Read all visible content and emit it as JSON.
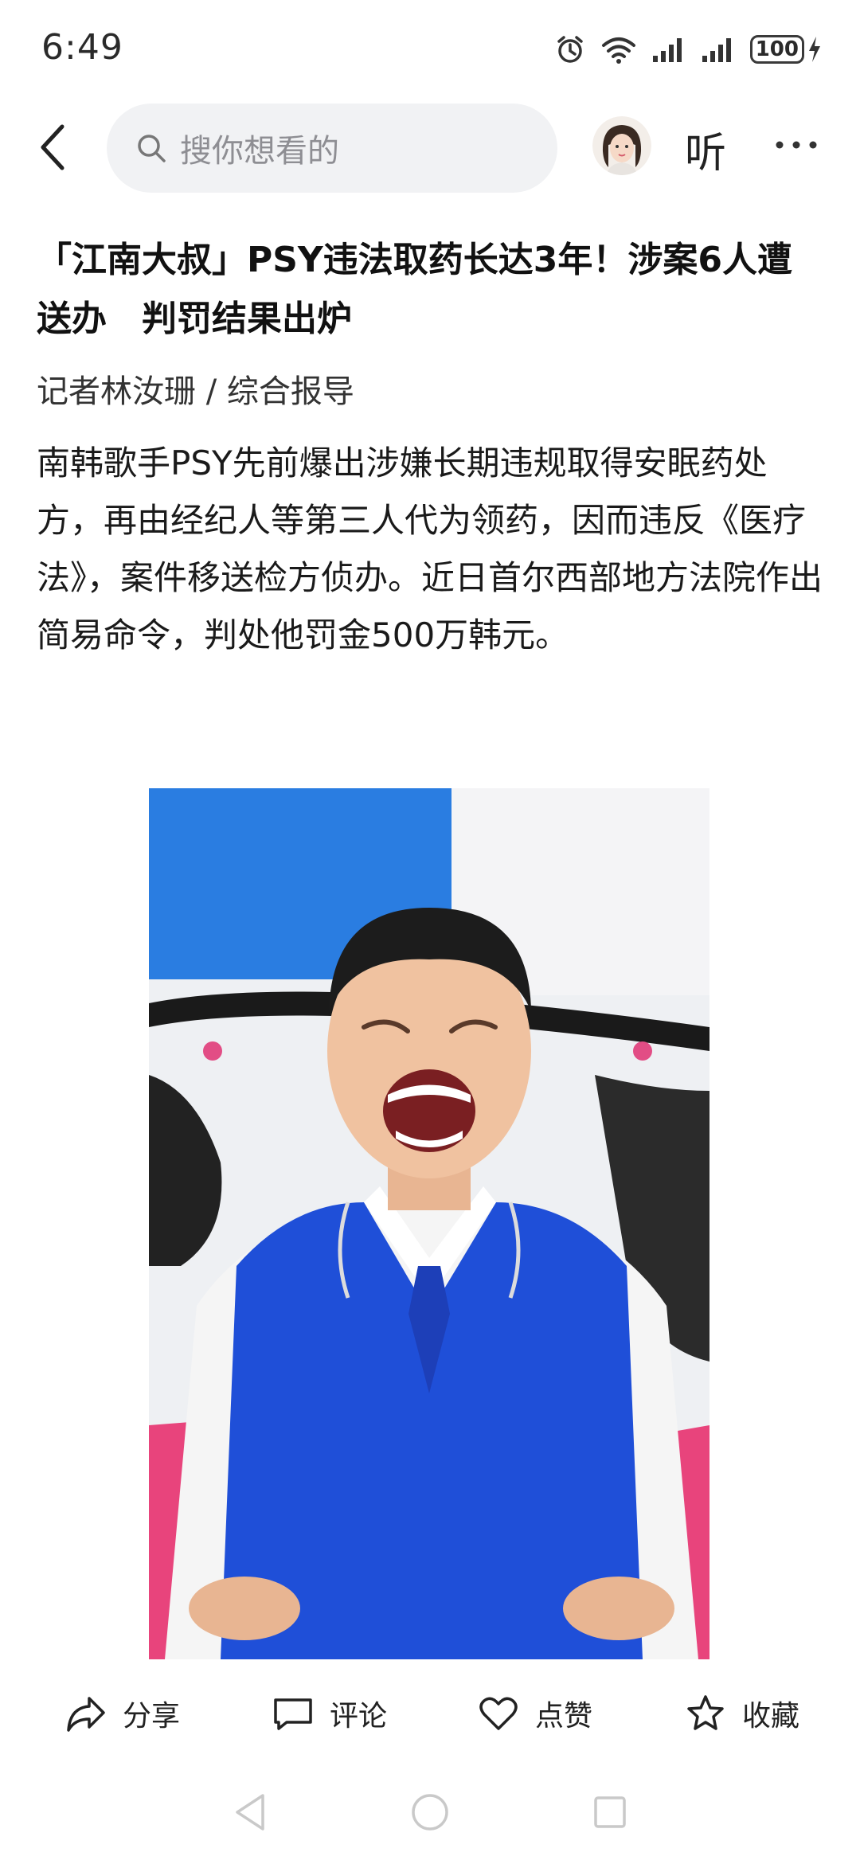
{
  "status_bar": {
    "time": "6:49",
    "battery": "100"
  },
  "nav": {
    "search_placeholder": "搜你想看的",
    "listen_label": "听"
  },
  "article": {
    "title": "「江南大叔」PSY违法取药长达3年！涉案6人遭送办　判罚结果出炉",
    "byline": "记者林汝珊 / 综合报导",
    "body": "南韩歌手PSY先前爆出涉嫌长期违规取得安眠药处方，再由经纪人等第三人代为领药，因而违反《医疗法》，案件移送检方侦办。近日首尔西部地方法院作出简易命令，判处他罚金500万韩元。"
  },
  "actions": {
    "share": "分享",
    "comment": "评论",
    "like": "点赞",
    "favorite": "收藏"
  },
  "colors": {
    "accent_blue": "#1f4fd8",
    "search_bg": "#f1f2f4",
    "text_primary": "#111111",
    "text_placeholder": "#8e8e93"
  }
}
